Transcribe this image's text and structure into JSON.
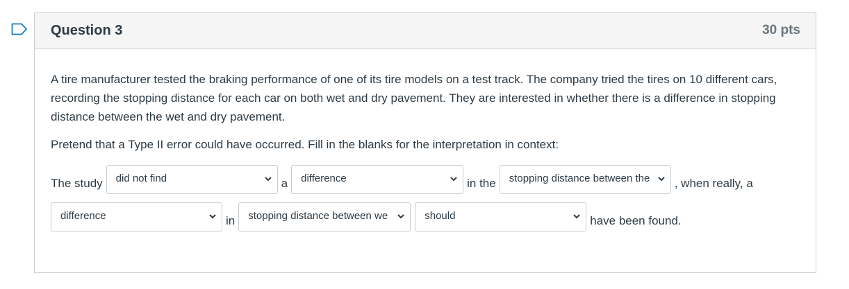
{
  "question": {
    "title": "Question 3",
    "points": "30 pts",
    "paragraphs": [
      "A tire manufacturer tested the braking performance of one of its tire models on a test track. The company tried the tires on 10 different cars, recording the stopping distance for each car on both wet and dry pavement. They are interested in whether there is a difference in stopping distance between the wet and dry pavement.",
      "Pretend that a Type II error could have occurred.  Fill in the blanks for the interpretation in context:"
    ]
  },
  "sentence": {
    "text_1": "The study",
    "text_2": "a",
    "text_3": "in the",
    "text_4": ", when really, a",
    "text_5": "in",
    "text_6": "have been found."
  },
  "dropdowns": [
    {
      "selected": "did not find"
    },
    {
      "selected": "difference"
    },
    {
      "selected": "stopping distance between the"
    },
    {
      "selected": "difference"
    },
    {
      "selected": "stopping distance between we"
    },
    {
      "selected": "should"
    }
  ],
  "icons": {
    "flag": "flag-icon",
    "chevron": "chevron-down-icon"
  },
  "colors": {
    "flag": "#1f78b4",
    "header_background": "#f5f5f5",
    "border": "#c7cdd1",
    "text": "#2d3b45",
    "points_text": "#6b7780"
  }
}
